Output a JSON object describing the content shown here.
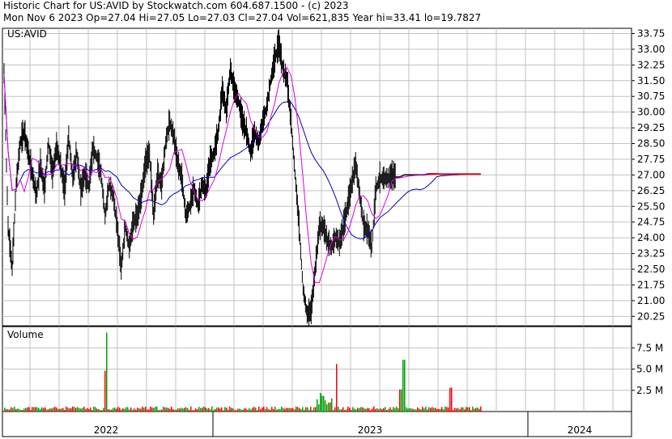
{
  "header": {
    "line1": "Historic Chart for US:AVID by Stockwatch.com 604.687.1500 - (c) 2023",
    "line2": "Mon Nov  6 2023   Op=27.04   Hi=27.05   Lo=27.03   Cl=27.04   Vol=621,835   Year hi=33.41   lo=19.7827"
  },
  "colors": {
    "price": "#000000",
    "ma_short": "#e000e0",
    "ma_long": "#0000c0",
    "recent": "#ff0000",
    "vol_up": "#00a000",
    "vol_down": "#ff0000",
    "grid": "#c0c0c0"
  },
  "chart_data": [
    {
      "type": "line",
      "panel": "price",
      "label": "US:AVID",
      "ylim": [
        19.8,
        34.0
      ],
      "yticks": [
        "33.75",
        "33.00",
        "32.25",
        "31.50",
        "30.75",
        "30.00",
        "29.25",
        "28.50",
        "27.75",
        "27.00",
        "26.25",
        "25.50",
        "24.75",
        "24.00",
        "23.25",
        "22.50",
        "21.75",
        "21.00",
        "20.25"
      ],
      "x_labels": [
        "2022",
        "2023",
        "2024"
      ],
      "note_series": [
        {
          "name": "price",
          "x": [
            0,
            5,
            10,
            15,
            20,
            25,
            30,
            35,
            40,
            45,
            50,
            55,
            60,
            65,
            70,
            75,
            80,
            85,
            90,
            95,
            100,
            105,
            110,
            115,
            120,
            125,
            130,
            135,
            140,
            145,
            150,
            155,
            160,
            165,
            170,
            175,
            180,
            185,
            190,
            195,
            200,
            205,
            210,
            215,
            220,
            225,
            230,
            235,
            240,
            245,
            250,
            255,
            260,
            265,
            270,
            275,
            280,
            285,
            290,
            295,
            300,
            305,
            310,
            315,
            320,
            325,
            330,
            335,
            340,
            345,
            350,
            355,
            360,
            365,
            370,
            375,
            380,
            385,
            390,
            395,
            400,
            405,
            410,
            415,
            420,
            425,
            430,
            435,
            440,
            445,
            450,
            455,
            460,
            465,
            470,
            475,
            480,
            485,
            490,
            495,
            500,
            505,
            510,
            515,
            520,
            525,
            530,
            535,
            540,
            545,
            550,
            555,
            560,
            565,
            570,
            575,
            580,
            585,
            590
          ],
          "y": [
            31.8,
            24.5,
            22.5,
            26.5,
            28.5,
            29.0,
            28.0,
            27.0,
            26.0,
            27.5,
            26.2,
            28.5,
            27.0,
            28.3,
            27.4,
            26.2,
            28.8,
            26.8,
            28.0,
            26.2,
            27.0,
            26.4,
            28.2,
            27.8,
            27.0,
            25.0,
            26.5,
            26.0,
            24.5,
            22.5,
            24.5,
            23.5,
            24.7,
            25.0,
            26.0,
            27.5,
            28.0,
            25.0,
            27.0,
            26.5,
            28.5,
            29.5,
            28.8,
            27.5,
            26.8,
            25.0,
            25.5,
            26.3,
            25.5,
            26.5,
            26.2,
            27.6,
            28.0,
            29.0,
            31.0,
            30.0,
            32.0,
            31.0,
            30.5,
            29.5,
            29.0,
            28.0,
            29.0,
            28.5,
            29.5,
            30.2,
            31.5,
            32.5,
            33.2,
            32.0,
            31.5,
            29.5,
            27.0,
            24.5,
            21.5,
            20.3,
            20.5,
            22.5,
            24.5,
            24.5,
            23.8,
            23.5,
            24.0,
            23.7,
            24.5,
            25.5,
            26.5,
            27.5,
            26.0,
            24.5,
            24.3,
            23.5,
            26.3,
            26.8,
            26.8,
            26.8,
            26.9,
            26.9,
            26.9,
            27.0,
            27.0,
            27.0,
            27.0,
            27.0,
            27.0,
            27.05,
            27.05,
            27.05,
            27.04,
            27.04,
            27.04,
            27.04,
            27.04,
            27.04,
            27.04,
            27.04,
            27.04,
            27.04,
            27.04
          ]
        }
      ]
    },
    {
      "type": "bar",
      "panel": "volume",
      "label": "Volume",
      "ylim": [
        0,
        10.0
      ],
      "yticks": [
        "7.5 M",
        "5.0 M",
        "2.5 M"
      ]
    }
  ]
}
